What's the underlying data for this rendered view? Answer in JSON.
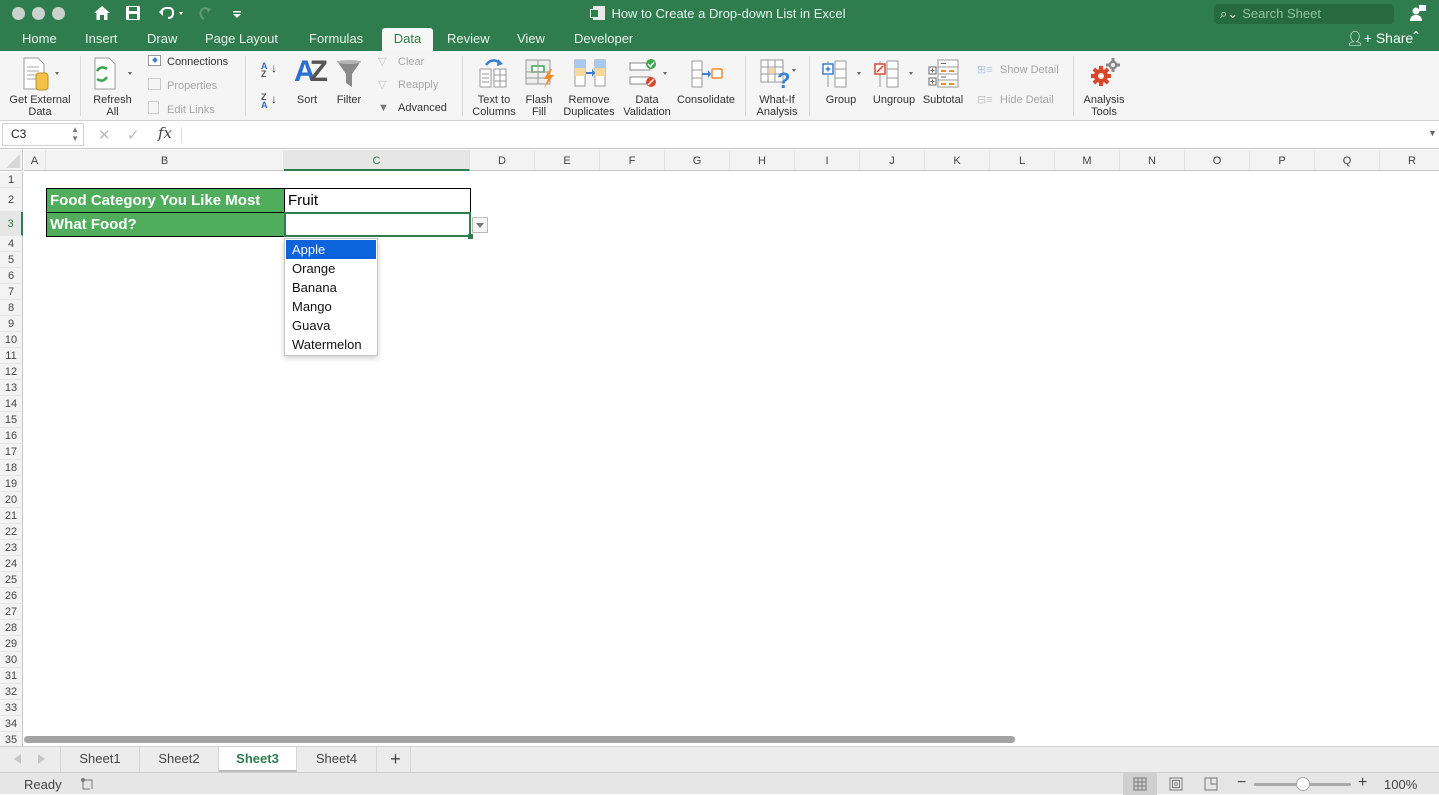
{
  "window": {
    "title": "How to Create a Drop-down List in Excel",
    "search_placeholder": "Search Sheet",
    "share_label": "Share"
  },
  "tabs": [
    {
      "label": "Home"
    },
    {
      "label": "Insert"
    },
    {
      "label": "Draw"
    },
    {
      "label": "Page Layout"
    },
    {
      "label": "Formulas"
    },
    {
      "label": "Data",
      "active": true
    },
    {
      "label": "Review"
    },
    {
      "label": "View"
    },
    {
      "label": "Developer"
    }
  ],
  "ribbon": {
    "get_external_data": "Get External Data",
    "get_external_data_l1": "Get External",
    "get_external_data_l2": "Data",
    "refresh_all_l1": "Refresh",
    "refresh_all_l2": "All",
    "connections": "Connections",
    "properties": "Properties",
    "edit_links": "Edit Links",
    "sort": "Sort",
    "filter": "Filter",
    "clear": "Clear",
    "reapply": "Reapply",
    "advanced": "Advanced",
    "text_to_columns_l1": "Text to",
    "text_to_columns_l2": "Columns",
    "flash_fill_l1": "Flash",
    "flash_fill_l2": "Fill",
    "remove_duplicates_l1": "Remove",
    "remove_duplicates_l2": "Duplicates",
    "data_validation_l1": "Data",
    "data_validation_l2": "Validation",
    "consolidate": "Consolidate",
    "what_if_l1": "What-If",
    "what_if_l2": "Analysis",
    "group": "Group",
    "ungroup": "Ungroup",
    "subtotal": "Subtotal",
    "show_detail": "Show Detail",
    "hide_detail": "Hide Detail",
    "analysis_tools_l1": "Analysis",
    "analysis_tools_l2": "Tools"
  },
  "formula_bar": {
    "name_box": "C3",
    "formula": "",
    "fx_label": "fx"
  },
  "columns": [
    "A",
    "B",
    "C",
    "D",
    "E",
    "F",
    "G",
    "H",
    "I",
    "J",
    "K",
    "L",
    "M",
    "N",
    "O",
    "P",
    "Q",
    "R"
  ],
  "rows": [
    "1",
    "2",
    "3",
    "4",
    "5",
    "6",
    "7",
    "8",
    "9",
    "10",
    "11",
    "12",
    "13",
    "14",
    "15",
    "16",
    "17",
    "18",
    "19",
    "20",
    "21",
    "22",
    "23",
    "24",
    "25",
    "26",
    "27",
    "28",
    "29",
    "30",
    "31",
    "32",
    "33",
    "34",
    "35"
  ],
  "selected_cell": {
    "column": "C",
    "row": "3"
  },
  "cells": {
    "B2": "Food Category You Like Most",
    "C2": "Fruit",
    "B3": "What Food?",
    "C3": ""
  },
  "dropdown": {
    "options": [
      "Apple",
      "Orange",
      "Banana",
      "Mango",
      "Guava",
      "Watermelon"
    ],
    "highlighted": "Apple"
  },
  "sheets": [
    {
      "label": "Sheet1"
    },
    {
      "label": "Sheet2"
    },
    {
      "label": "Sheet3",
      "active": true
    },
    {
      "label": "Sheet4"
    }
  ],
  "add_sheet_label": "+",
  "status": {
    "ready": "Ready",
    "zoom": "100%",
    "zoom_minus": "−",
    "zoom_plus": "+"
  },
  "colors": {
    "accent": "#2f7d4e",
    "label_fill": "#4fad5b",
    "dropdown_highlight": "#0d63dc"
  }
}
